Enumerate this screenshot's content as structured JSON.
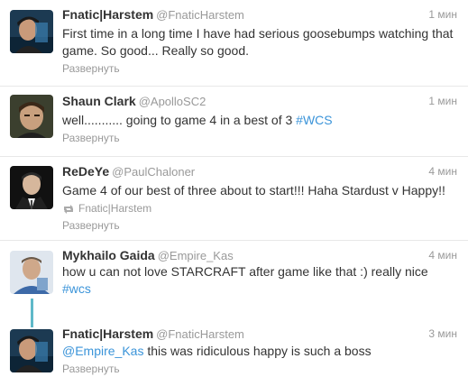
{
  "tweets": [
    {
      "fullname": "Fnatic|Harstem",
      "username": "@FnaticHarstem",
      "time": "1 мин",
      "text": "First time in a long time I have had serious goosebumps watching that game. So good... Really so good.",
      "expand": "Развернуть"
    },
    {
      "fullname": "Shaun Clark",
      "username": "@ApolloSC2",
      "time": "1 мин",
      "text_before": "well........... going to game 4 in a best of 3 ",
      "hashtag": "#WCS",
      "expand": "Развернуть"
    },
    {
      "fullname": "ReDeYe",
      "username": "@PaulChaloner",
      "time": "4 мин",
      "text": "Game 4 of our best of three about to start!!! Haha Stardust v Happy!!",
      "retweeted_by": "Fnatic|Harstem",
      "expand": "Развернуть"
    },
    {
      "fullname": "Mykhailo Gaida",
      "username": "@Empire_Kas",
      "time": "4 мин",
      "text_before": "how u can not love STARCRAFT after game like that :) really nice ",
      "hashtag": "#wcs"
    },
    {
      "fullname": "Fnatic|Harstem",
      "username": "@FnaticHarstem",
      "time": "3 мин",
      "mention": "@Empire_Kas",
      "text_after": " this was ridiculous happy is such a boss",
      "expand": "Развернуть"
    }
  ],
  "colors": {
    "link": "#3b94d9",
    "muted": "#999999",
    "text": "#333333",
    "thread_line": "#5fb9c9"
  }
}
